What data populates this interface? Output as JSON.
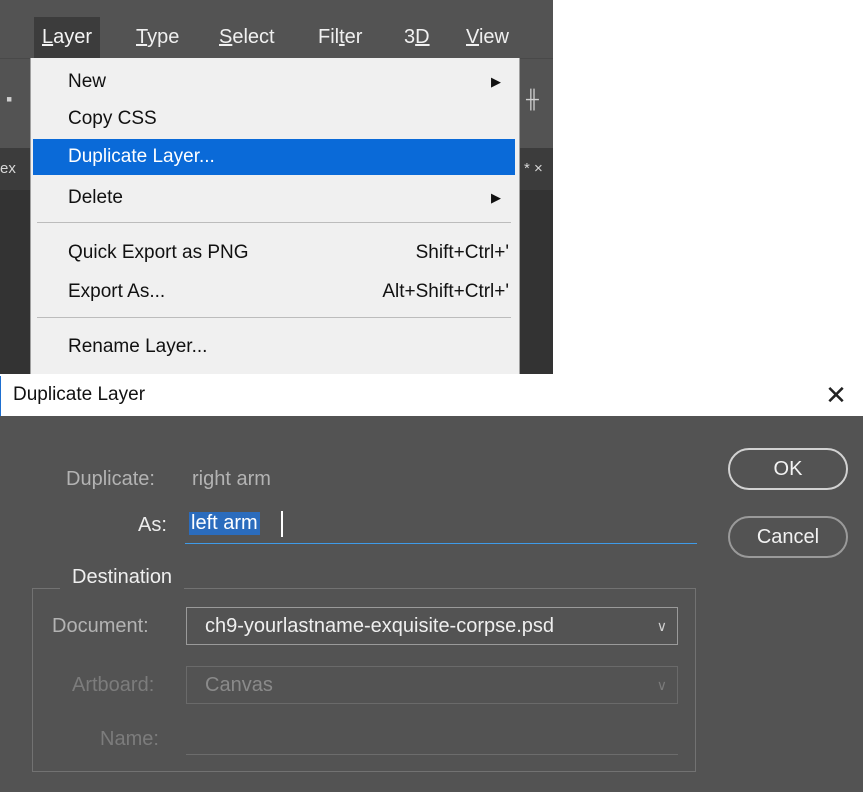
{
  "menubar": {
    "items": [
      {
        "label": "Layer",
        "active": true
      },
      {
        "label": "Type"
      },
      {
        "label": "Select"
      },
      {
        "label": "Filter"
      },
      {
        "label": "3D"
      },
      {
        "label": "View"
      }
    ]
  },
  "tabs": {
    "left_fragment": "ex",
    "right_fragment": "* ×"
  },
  "layer_menu": {
    "items": [
      {
        "label": "New",
        "submenu_icon": "triangle-right"
      },
      {
        "label": "Copy CSS"
      },
      {
        "label": "Duplicate Layer...",
        "highlighted": true
      },
      {
        "label": "Delete",
        "submenu_icon": "triangle-right"
      },
      {
        "label": "Quick Export as PNG",
        "shortcut": "Shift+Ctrl+'"
      },
      {
        "label": "Export As...",
        "shortcut": "Alt+Shift+Ctrl+'"
      },
      {
        "label": "Rename Layer..."
      }
    ]
  },
  "dialog": {
    "title": "Duplicate Layer",
    "close_icon": "close-x",
    "duplicate_label": "Duplicate:",
    "duplicate_value": "right arm",
    "as_label": "As:",
    "as_value": "left arm",
    "ok_label": "OK",
    "cancel_label": "Cancel",
    "destination_legend": "Destination",
    "document_label": "Document:",
    "document_value": "ch9-yourlastname-exquisite-corpse.psd",
    "artboard_label": "Artboard:",
    "artboard_value": "Canvas",
    "name_label": "Name:",
    "name_value": ""
  },
  "colors": {
    "highlight": "#0a6ad8",
    "dialog_bg": "#535353",
    "selection_bg": "#2b6cbd",
    "focus_underline": "#3f9be8"
  }
}
